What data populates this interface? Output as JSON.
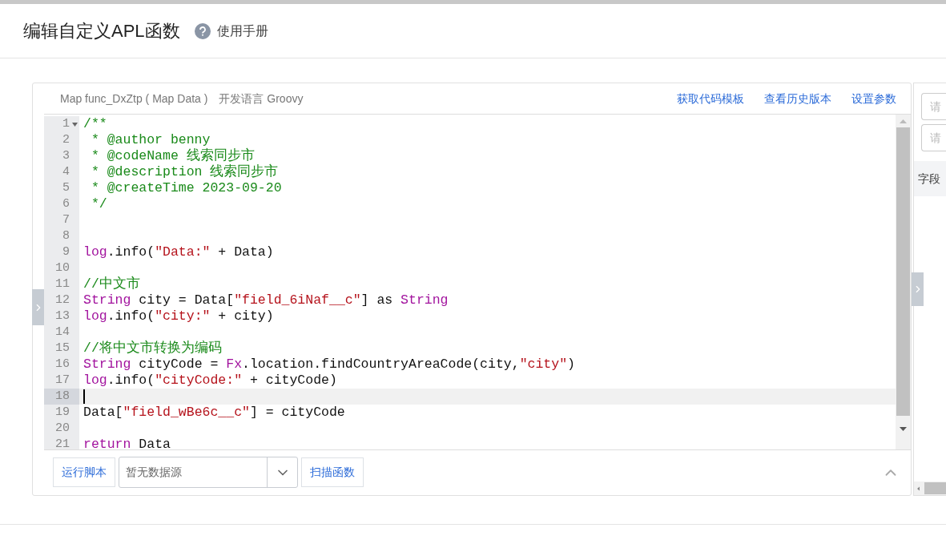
{
  "header": {
    "title": "编辑自定义APL函数",
    "help_link": "使用手册"
  },
  "editor": {
    "signature": "Map func_DxZtp ( Map Data )",
    "language": "开发语言 Groovy",
    "actions": [
      "获取代码模板",
      "查看历史版本",
      "设置参数"
    ],
    "lines": [
      {
        "number": "1",
        "foldable": true,
        "active": false,
        "tokens": [
          {
            "kind": "comment",
            "text": "/**"
          }
        ]
      },
      {
        "number": "2",
        "foldable": false,
        "active": false,
        "tokens": [
          {
            "kind": "comment",
            "text": " * @author benny"
          }
        ]
      },
      {
        "number": "3",
        "foldable": false,
        "active": false,
        "tokens": [
          {
            "kind": "comment",
            "text": " * @codeName 线索同步市"
          }
        ]
      },
      {
        "number": "4",
        "foldable": false,
        "active": false,
        "tokens": [
          {
            "kind": "comment",
            "text": " * @description 线索同步市"
          }
        ]
      },
      {
        "number": "5",
        "foldable": false,
        "active": false,
        "tokens": [
          {
            "kind": "comment",
            "text": " * @createTime 2023-09-20"
          }
        ]
      },
      {
        "number": "6",
        "foldable": false,
        "active": false,
        "tokens": [
          {
            "kind": "comment",
            "text": " */"
          }
        ]
      },
      {
        "number": "7",
        "foldable": false,
        "active": false
      },
      {
        "number": "8",
        "foldable": false,
        "active": false
      },
      {
        "number": "9",
        "foldable": false,
        "active": false,
        "tokens": [
          {
            "kind": "keyword",
            "text": "log"
          },
          {
            "kind": "plain",
            "text": ".info("
          },
          {
            "kind": "string",
            "text": "\"Data:\""
          },
          {
            "kind": "plain",
            "text": " + Data)"
          }
        ]
      },
      {
        "number": "10",
        "foldable": false,
        "active": false
      },
      {
        "number": "11",
        "foldable": false,
        "active": false,
        "tokens": [
          {
            "kind": "comment",
            "text": "//中文市"
          }
        ]
      },
      {
        "number": "12",
        "foldable": false,
        "active": false,
        "tokens": [
          {
            "kind": "keyword",
            "text": "String"
          },
          {
            "kind": "plain",
            "text": " city = Data["
          },
          {
            "kind": "string",
            "text": "\"field_6iNaf__c\""
          },
          {
            "kind": "plain",
            "text": "] as "
          },
          {
            "kind": "keyword",
            "text": "String"
          }
        ]
      },
      {
        "number": "13",
        "foldable": false,
        "active": false,
        "tokens": [
          {
            "kind": "keyword",
            "text": "log"
          },
          {
            "kind": "plain",
            "text": ".info("
          },
          {
            "kind": "string",
            "text": "\"city:\""
          },
          {
            "kind": "plain",
            "text": " + city)"
          }
        ]
      },
      {
        "number": "14",
        "foldable": false,
        "active": false
      },
      {
        "number": "15",
        "foldable": false,
        "active": false,
        "tokens": [
          {
            "kind": "comment",
            "text": "//将中文市转换为编码"
          }
        ]
      },
      {
        "number": "16",
        "foldable": false,
        "active": false,
        "tokens": [
          {
            "kind": "keyword",
            "text": "String"
          },
          {
            "kind": "plain",
            "text": " cityCode = "
          },
          {
            "kind": "keyword",
            "text": "Fx"
          },
          {
            "kind": "plain",
            "text": ".location.findCountryAreaCode(city,"
          },
          {
            "kind": "string",
            "text": "\"city\""
          },
          {
            "kind": "plain",
            "text": ")"
          }
        ]
      },
      {
        "number": "17",
        "foldable": false,
        "active": false,
        "tokens": [
          {
            "kind": "keyword",
            "text": "log"
          },
          {
            "kind": "plain",
            "text": ".info("
          },
          {
            "kind": "string",
            "text": "\"cityCode:\""
          },
          {
            "kind": "plain",
            "text": " + cityCode)"
          }
        ]
      },
      {
        "number": "18",
        "foldable": false,
        "active": true
      },
      {
        "number": "19",
        "foldable": false,
        "active": false,
        "tokens": [
          {
            "kind": "plain",
            "text": "Data["
          },
          {
            "kind": "string",
            "text": "\"field_wBe6c__c\""
          },
          {
            "kind": "plain",
            "text": "] = cityCode"
          }
        ]
      },
      {
        "number": "20",
        "foldable": false,
        "active": false
      },
      {
        "number": "21",
        "foldable": false,
        "active": false,
        "tokens": [
          {
            "kind": "keyword",
            "text": "return"
          },
          {
            "kind": "plain",
            "text": " Data"
          }
        ]
      }
    ],
    "run_button": "运行脚本",
    "datasource": {
      "value": "暂无数据源"
    },
    "scan_button": "扫描函数"
  },
  "side_panel": {
    "fields": [
      {
        "placeholder": "请"
      },
      {
        "placeholder": "请"
      }
    ],
    "column_1": "字段"
  }
}
